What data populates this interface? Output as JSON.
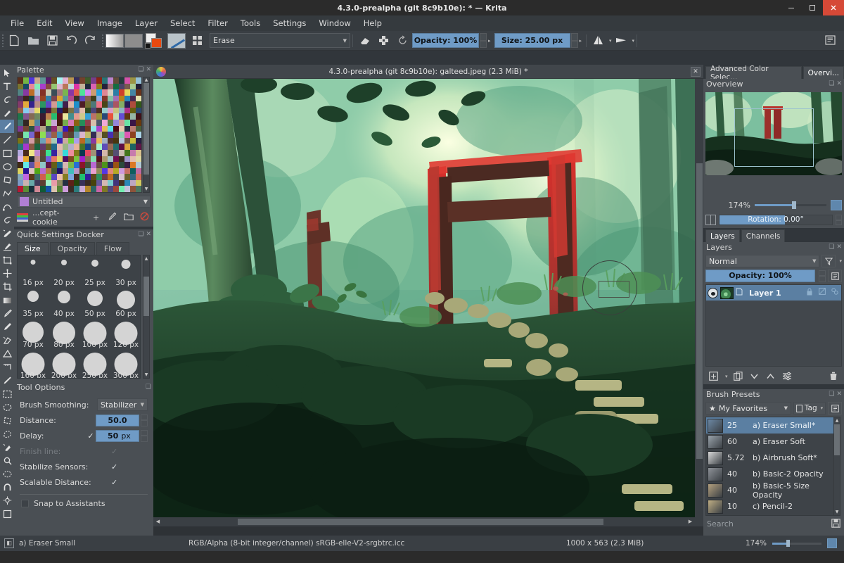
{
  "window": {
    "title": "4.3.0-prealpha (git 8c9b10e):  * — Krita",
    "minimize_label": "–",
    "maximize_label": "☐",
    "close_label": "✕"
  },
  "menubar": {
    "items": [
      "File",
      "Edit",
      "View",
      "Image",
      "Layer",
      "Select",
      "Filter",
      "Tools",
      "Settings",
      "Window",
      "Help"
    ]
  },
  "toolbar": {
    "new_label": "new-document",
    "open_label": "open-document",
    "save_label": "save-document",
    "undo_label": "undo",
    "redo_label": "redo",
    "gradient_label": "gradient-preview",
    "pattern_label": "pattern-preview",
    "fgbg_label": "foreground-background-colors",
    "brush_preview_label": "brush-preview",
    "preset_chooser_label": "preset-chooser",
    "preset_name": "Erase",
    "eraser_label": "eraser-toggle",
    "preserve_alpha_label": "preserve-alpha",
    "reset_label": "reload-preset",
    "opacity": "Opacity: 100%",
    "size": "Size: 25.00 px",
    "mirror_h_label": "mirror-horizontal",
    "mirror_v_label": "mirror-vertical",
    "workspace_label": "choose-workspace"
  },
  "tools": {
    "items": [
      "select-shapes",
      "text",
      "calligraphy",
      "edit-shapes",
      "freehand-brush",
      "line",
      "rectangle",
      "ellipse",
      "polygon",
      "polyline",
      "bezier-curve",
      "freehand-path",
      "dynamic-brush",
      "multibrush",
      "transform",
      "move",
      "crop",
      "gradient",
      "color-sampler",
      "colorize-mask",
      "smart-patch",
      "assistant-editor",
      "measure",
      "perspective",
      "reference-images",
      "fill",
      "rectangular-selection",
      "elliptical-selection",
      "polygonal-selection",
      "freehand-selection",
      "contiguous-selection",
      "similar-color-selection",
      "bezier-selection",
      "magnetic-selection",
      "pan",
      "zoom"
    ],
    "selected_index": 4
  },
  "palette_dock": {
    "title": "Palette",
    "float_label": "float-docker",
    "close_label": "close-docker",
    "selected_color_name": "Untitled",
    "palette_file": "...cept-cookie",
    "add_label": "+",
    "edit_label": "edit-color",
    "folder_label": "open-palette",
    "remove_label": "remove-color"
  },
  "quick_settings": {
    "title": "Quick Settings Docker",
    "tabs": [
      {
        "label": "Size",
        "active": true
      },
      {
        "label": "Opacity",
        "active": false
      },
      {
        "label": "Flow",
        "active": false
      }
    ],
    "sizes": [
      [
        {
          "label": "16 px",
          "d": 7
        },
        {
          "label": "20 px",
          "d": 8
        },
        {
          "label": "25 px",
          "d": 10
        },
        {
          "label": "30 px",
          "d": 13
        }
      ],
      [
        {
          "label": "35 px",
          "d": 16
        },
        {
          "label": "40 px",
          "d": 18
        },
        {
          "label": "50 px",
          "d": 22
        },
        {
          "label": "60 px",
          "d": 26
        }
      ],
      [
        {
          "label": "70 px",
          "d": 30
        },
        {
          "label": "80 px",
          "d": 32
        },
        {
          "label": "100 px",
          "d": 33
        },
        {
          "label": "120 px",
          "d": 33
        }
      ],
      [
        {
          "label": "160 px",
          "d": 33
        },
        {
          "label": "200 px",
          "d": 33
        },
        {
          "label": "250 px",
          "d": 33
        },
        {
          "label": "300 px",
          "d": 33
        }
      ]
    ]
  },
  "tool_options": {
    "title": "Tool Options",
    "brush_smoothing_label": "Brush Smoothing:",
    "brush_smoothing_value": "Stabilizer",
    "distance_label": "Distance:",
    "distance_value": "50.0",
    "delay_label": "Delay:",
    "delay_value": "50",
    "delay_unit": "px",
    "delay_checked": "✓",
    "finish_line_label": "Finish line:",
    "finish_line_checked": "✓",
    "stabilize_sensors_label": "Stabilize Sensors:",
    "stabilize_sensors_checked": "✓",
    "scalable_distance_label": "Scalable Distance:",
    "scalable_distance_checked": "✓",
    "snap_to_assistants_label": "Snap to Assistants"
  },
  "canvas": {
    "tab_title": "4.3.0-prealpha (git 8c9b10e): galteed.jpeg (2.3 MiB) *",
    "close_label": "✕",
    "logo_label": "krita-logo",
    "artwork_description": "Digital painting of a red torii gate in a lush green forest with stone steps and foliage"
  },
  "right_tabs": {
    "items": [
      {
        "label": "Advanced Color Selec...",
        "active": false
      },
      {
        "label": "Overvi...",
        "active": true
      }
    ]
  },
  "overview_dock": {
    "title": "Overview",
    "float_label": "float-docker",
    "close_label": "close-docker",
    "zoom": "174%",
    "rotation": "Rotation: 0.00°",
    "mirror_label": "mirror-canvas",
    "fit_label": "fit-to-page"
  },
  "layers_tabs": {
    "items": [
      {
        "label": "Layers",
        "active": true
      },
      {
        "label": "Channels",
        "active": false
      }
    ]
  },
  "layers_dock": {
    "title": "Layers",
    "float_label": "float-docker",
    "close_label": "close-docker",
    "blend_mode": "Normal",
    "filter_label": "filter-layers",
    "opacity": "Opacity:  100%",
    "properties_label": "layer-properties",
    "rows": [
      {
        "name": "Layer 1",
        "visible_label": "visibility-eye",
        "thumbnail_label": "layer-thumbnail",
        "alpha_lock_label": "alpha-inherit",
        "lock_label": "lock-layer",
        "alpha_label": "alpha-lock",
        "style_label": "layer-style"
      }
    ],
    "toolbar": {
      "add_label": "add-layer",
      "add_arrow": "▾",
      "duplicate_label": "duplicate-layer",
      "move_down_label": "move-layer-down",
      "move_up_label": "move-layer-up",
      "properties_label": "layer-properties",
      "delete_label": "delete-layer"
    }
  },
  "brush_presets": {
    "title": "Brush Presets",
    "float_label": "float-docker",
    "close_label": "close-docker",
    "tag_filter": "My Favorites",
    "star_label": "★",
    "tag_button": "Tag",
    "settings_label": "preset-settings",
    "search_placeholder": "Search",
    "save_label": "save-preset",
    "items": [
      {
        "size": "25",
        "name": "a) Eraser Small*",
        "selected": true,
        "thumb": "#6c88a4"
      },
      {
        "size": "60",
        "name": "a) Eraser Soft",
        "selected": false,
        "thumb": "#9aa3ab"
      },
      {
        "size": "5.72",
        "name": "b) Airbrush Soft*",
        "selected": false,
        "thumb": "#d8d8d8"
      },
      {
        "size": "40",
        "name": "b) Basic-2 Opacity",
        "selected": false,
        "thumb": "#8e9298"
      },
      {
        "size": "40",
        "name": "b) Basic-5 Size Opacity",
        "selected": false,
        "thumb": "#b3a07e"
      },
      {
        "size": "10",
        "name": "c) Pencil-2",
        "selected": false,
        "thumb": "#bfae84"
      }
    ]
  },
  "statusbar": {
    "preset_icon_label": "current-preset-icon",
    "preset_name": "a) Eraser Small",
    "color_profile": "RGB/Alpha (8-bit integer/channel)  sRGB-elle-V2-srgbtrc.icc",
    "image_size": "1000 x 563 (2.3 MiB)",
    "zoom": "174%",
    "fit_label": "fit-page-icon"
  },
  "colors": {
    "accent": "#6f9bc6",
    "selection": "#5b7fa2",
    "panel": "#4a4f54",
    "toolbar": "#3a3f44",
    "titlebar": "#2b2b2b",
    "close_red": "#d64937",
    "foreground": "#efefef",
    "background": "#e8490f"
  }
}
